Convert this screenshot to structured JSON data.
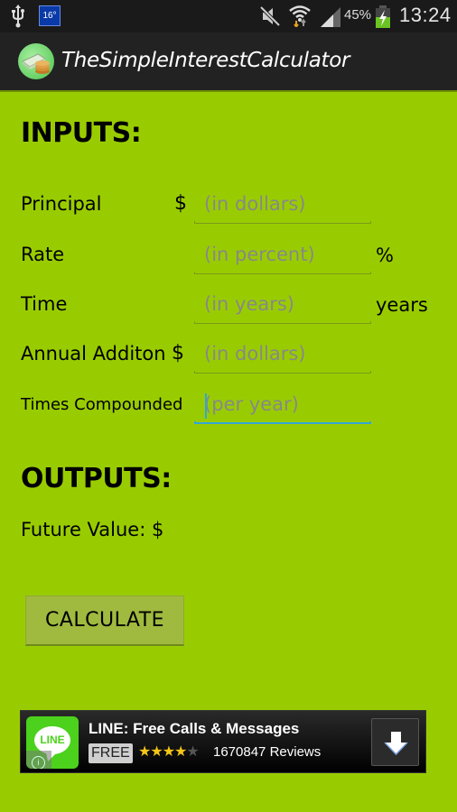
{
  "status_bar": {
    "weather_temp": "16°",
    "battery_percent": "45%",
    "time": "13:24",
    "icons": [
      "usb-icon",
      "weather-icon",
      "mute-icon",
      "wifi-icon",
      "signal-icon",
      "battery-charging-icon"
    ]
  },
  "action_bar": {
    "title": "TheSimpleInterestCalculator",
    "icon": "money-coins-icon"
  },
  "inputs": {
    "heading": "INPUTS:",
    "fields": [
      {
        "label": "Principal",
        "prefix": "$",
        "placeholder": "(in dollars)",
        "value": "",
        "suffix": ""
      },
      {
        "label": "Rate",
        "prefix": "",
        "placeholder": "(in percent)",
        "value": "",
        "suffix": "%"
      },
      {
        "label": "Time",
        "prefix": "",
        "placeholder": "(in years)",
        "value": "",
        "suffix": "years"
      },
      {
        "label": "Annual Additon",
        "prefix": "$",
        "placeholder": "(in dollars)",
        "value": "",
        "suffix": ""
      },
      {
        "label": "Times Compounded",
        "prefix": "",
        "placeholder": "(per year)",
        "value": "",
        "suffix": "",
        "focused": true
      }
    ]
  },
  "outputs": {
    "heading": "OUTPUTS:",
    "future_value_label": "Future Value: $",
    "future_value": ""
  },
  "calculate_label": "CALCULATE",
  "ad": {
    "app_name": "LINE: Free Calls & Messages",
    "icon_text": "LINE",
    "price": "FREE",
    "rating": 4,
    "rating_max": 5,
    "reviews": "1670847 Reviews",
    "info_icon": "i"
  },
  "colors": {
    "background": "#99cc00",
    "focus_accent": "#33a6d8",
    "button": "#a0b93f"
  }
}
